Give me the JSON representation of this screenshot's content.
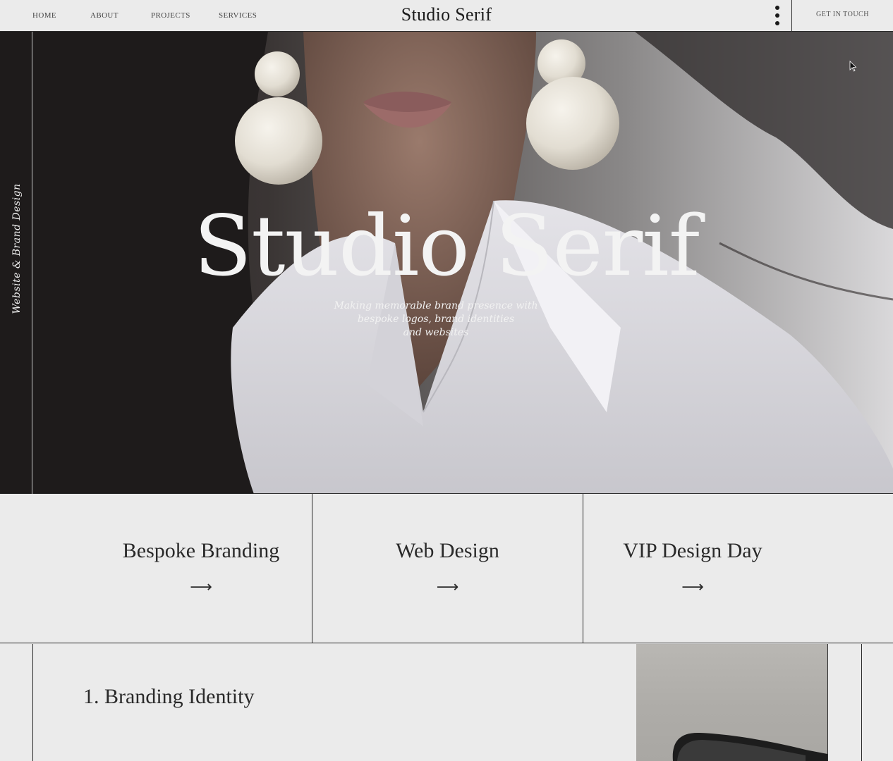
{
  "header": {
    "nav": [
      "HOME",
      "ABOUT",
      "PROJECTS",
      "SERVICES"
    ],
    "brand": "Studio Serif",
    "menu_icon": "kebab-menu-icon",
    "cta": "GET IN TOUCH"
  },
  "hero": {
    "vertical_tag": "Website & Brand Design",
    "title": "Studio Serif",
    "subtitle_lines": [
      "Making memorable brand presence with",
      "bespoke logos, brand identities",
      "and websites"
    ]
  },
  "services": [
    {
      "title": "Bespoke Branding",
      "arrow": "⟶"
    },
    {
      "title": "Web Design",
      "arrow": "⟶"
    },
    {
      "title": "VIP Design Day",
      "arrow": "⟶"
    }
  ],
  "section": {
    "heading": "1. Branding Identity"
  },
  "colors": {
    "background": "#ebebeb",
    "ink": "#2a2a2a",
    "hero_text": "#f3f3f3"
  }
}
